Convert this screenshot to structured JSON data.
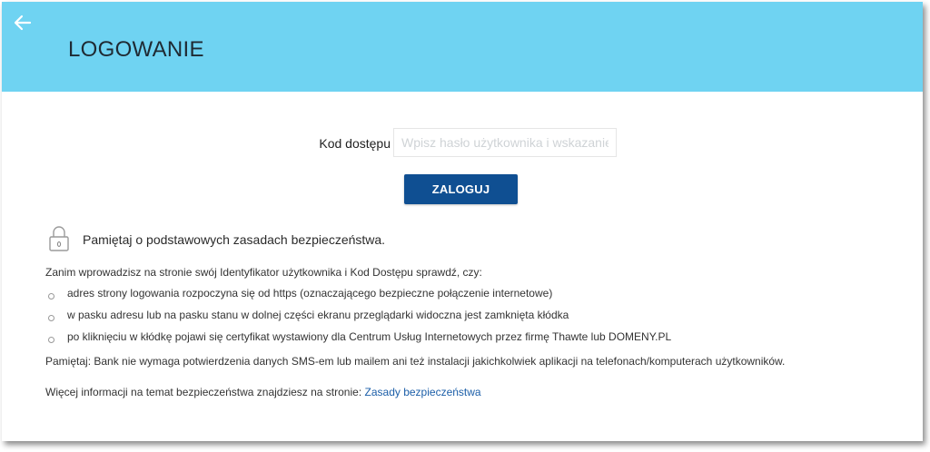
{
  "header": {
    "title": "LOGOWANIE",
    "back_icon": "arrow-left-icon",
    "bg_color": "#6fd3f2"
  },
  "login": {
    "code_label": "Kod dostępu",
    "code_placeholder": "Wpisz hasło użytkownika i wskazanie tok",
    "code_value": "",
    "submit_label": "ZALOGUJ",
    "button_color": "#0f4f92"
  },
  "security": {
    "icon": "padlock-icon",
    "title": "Pamiętaj o podstawowych zasadach bezpieczeństwa.",
    "intro": "Zanim wprowadzisz na stronie swój Identyfikator użytkownika i Kod Dostępu sprawdź, czy:",
    "items": [
      "adres strony logowania rozpoczyna się od https (oznaczającego bezpieczne połączenie internetowe)",
      "w pasku adresu lub na pasku stanu w dolnej części ekranu przeglądarki widoczna jest zamknięta kłódka",
      "po kliknięciu w kłódkę pojawi się certyfikat wystawiony dla Centrum Usług Internetowych przez firmę Thawte lub DOMENY.PL"
    ],
    "note": "Pamiętaj: Bank nie wymaga potwierdzenia danych SMS-em lub mailem ani też instalacji jakichkolwiek aplikacji na telefonach/komputerach użytkowników.",
    "more_info_text": "Więcej informacji na temat bezpieczeństwa znajdziesz na stronie:",
    "more_info_link": "Zasady bezpieczeństwa",
    "link_color": "#1b5ea8"
  }
}
